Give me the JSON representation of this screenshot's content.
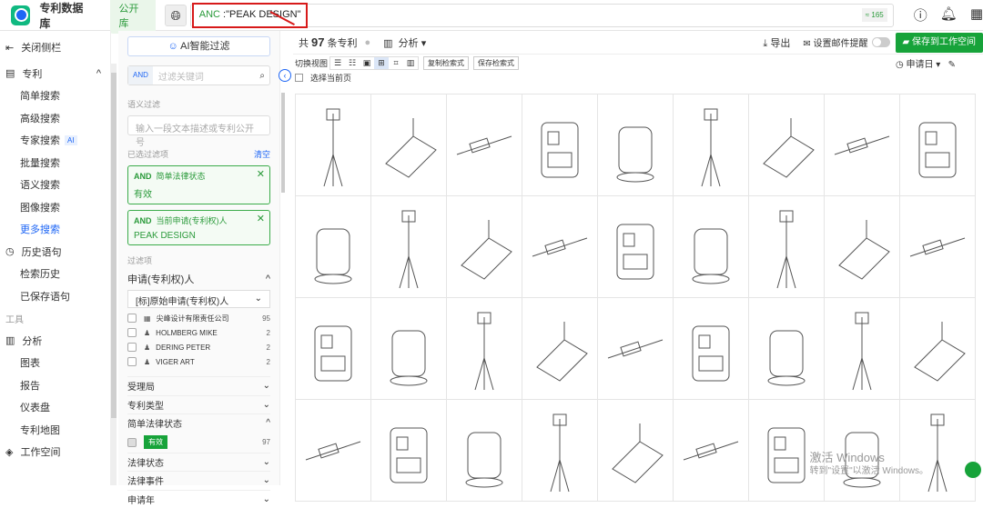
{
  "header": {
    "app_title": "专利数据库",
    "library": "公开库",
    "query_field": "ANC",
    "query_value": ":\"PEAK DESIGN\"",
    "count": "≈ 165"
  },
  "sidebar": {
    "close": "关闭侧栏",
    "patent": "专利",
    "items": [
      "简单搜索",
      "高级搜索",
      "专家搜索",
      "批量搜索",
      "语义搜索",
      "图像搜索",
      "更多搜索"
    ],
    "ai_badge": "AI",
    "history": "历史语句",
    "history_items": [
      "检索历史",
      "已保存语句"
    ],
    "tools": "工具",
    "analysis": "分析",
    "analysis_items": [
      "图表",
      "报告",
      "仪表盘",
      "专利地图"
    ],
    "workspace": "工作空间"
  },
  "filter": {
    "ai_filter": "AI智能过滤",
    "and": "AND",
    "keyword_placeholder": "过滤关键词",
    "semantic_label": "语义过滤",
    "semantic_placeholder": "输入一段文本描述或专利公开号",
    "selected_label": "已选过滤项",
    "clear": "清空",
    "chips": [
      {
        "op": "AND",
        "field": "简单法律状态",
        "value": "有效"
      },
      {
        "op": "AND",
        "field": "当前申请(专利权)人",
        "value": "PEAK DESIGN"
      }
    ],
    "filters_label": "过滤项",
    "applicant_label": "申请(专利权)人",
    "applicant_select": "[标]原始申请(专利权)人",
    "applicants": [
      {
        "name": "尖峰设计有限责任公司",
        "count": "95"
      },
      {
        "name": "HOLMBERG MIKE",
        "count": "2"
      },
      {
        "name": "DERING PETER",
        "count": "2"
      },
      {
        "name": "VIGER ART",
        "count": "2"
      }
    ],
    "sections": [
      "受理局",
      "专利类型",
      "简单法律状态"
    ],
    "status_value": "有效",
    "status_count": "97",
    "more_sections": [
      "法律状态",
      "法律事件",
      "申请年"
    ]
  },
  "main": {
    "total_prefix": "共",
    "total": "97",
    "total_suffix": "条专利",
    "analysis": "分析",
    "export": "导出",
    "email_alert": "设置邮件提醒",
    "save_workspace": "保存到工作空间",
    "switch_view": "切换视图",
    "copy_query": "复制检索式",
    "save_query": "保存检索式",
    "sort": "申请日",
    "select_page": "选择当前页"
  },
  "watermark": {
    "line1": "激活 Windows",
    "line2": "转到\"设置\"以激活 Windows。"
  }
}
